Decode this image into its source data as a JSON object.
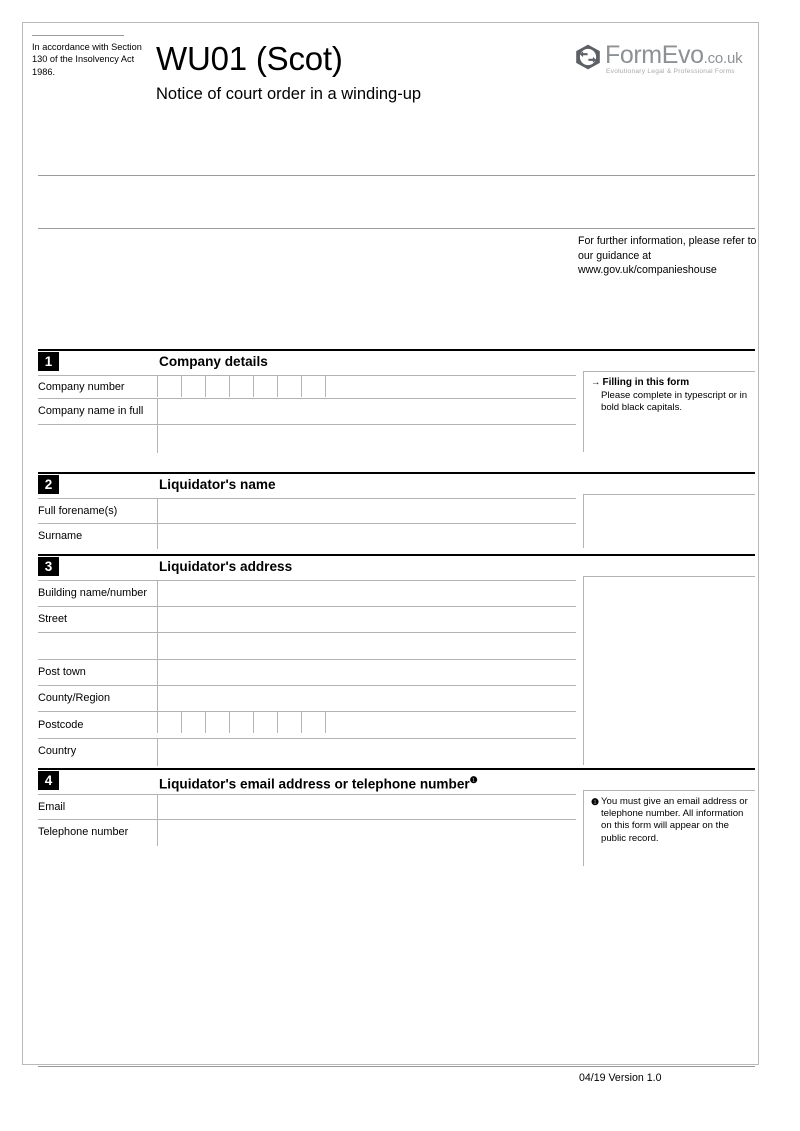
{
  "header": {
    "accordance_text": "In accordance with Section 130 of the Insolvency Act 1986.",
    "form_code": "WU01 (Scot)",
    "form_subtitle": "Notice of court order in a winding-up",
    "guidance_text": "For further information, please refer to our guidance at www.gov.uk/companieshouse"
  },
  "logo": {
    "name_main": "FormEvo",
    "name_tld": ".co.uk",
    "tagline": "Evolutionary Legal & Professional Forms",
    "icon": "hexagon-arrows-icon",
    "color": "#8e9194"
  },
  "sections": [
    {
      "number": "1",
      "title": "Company details",
      "fields": [
        {
          "label": "Company number",
          "type": "charboxes",
          "boxes": 8,
          "value": ""
        },
        {
          "label": "Company name in full",
          "type": "text",
          "value": ""
        },
        {
          "label": "",
          "type": "text",
          "value": ""
        }
      ],
      "note": {
        "arrow": "→",
        "title": "Filling in this form",
        "body": "Please complete in typescript or in bold black capitals."
      }
    },
    {
      "number": "2",
      "title": "Liquidator's name",
      "fields": [
        {
          "label": "Full forename(s)",
          "type": "text",
          "value": ""
        },
        {
          "label": "Surname",
          "type": "text",
          "value": ""
        }
      ],
      "note": null
    },
    {
      "number": "3",
      "title": "Liquidator's address",
      "fields": [
        {
          "label": "Building name/number",
          "type": "text",
          "value": ""
        },
        {
          "label": "Street",
          "type": "text",
          "value": ""
        },
        {
          "label": "",
          "type": "text",
          "value": ""
        },
        {
          "label": "Post town",
          "type": "text",
          "value": ""
        },
        {
          "label": "County/Region",
          "type": "text",
          "value": ""
        },
        {
          "label": "Postcode",
          "type": "charboxes",
          "boxes": 8,
          "value": ""
        },
        {
          "label": "Country",
          "type": "text",
          "value": ""
        }
      ],
      "note": null
    },
    {
      "number": "4",
      "title": "Liquidator's email address or telephone number",
      "title_superscript": "❶",
      "fields": [
        {
          "label": "Email",
          "type": "text",
          "value": ""
        },
        {
          "label": "Telephone number",
          "type": "text",
          "value": ""
        }
      ],
      "note": {
        "bullet": "❶",
        "body": "You must give an email address or telephone number. All information on this form will appear on the public record."
      }
    }
  ],
  "footer": {
    "version": "04/19 Version 1.0"
  }
}
